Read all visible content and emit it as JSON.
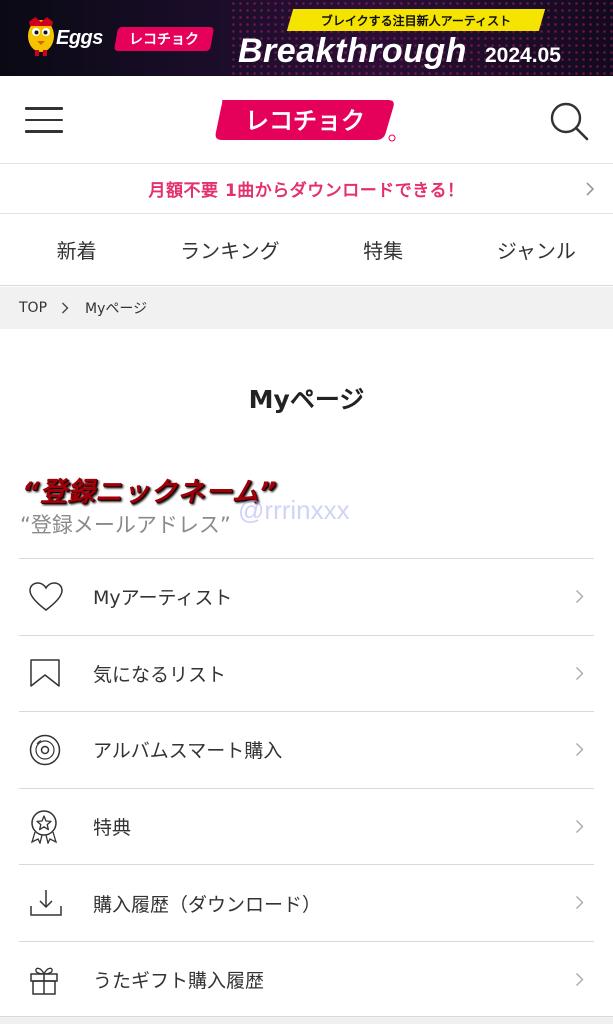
{
  "banner": {
    "brand_eggs": "Eggs",
    "brand_recochoku": "レコチョク",
    "tagline": "ブレイクする注目新人アーティスト",
    "title": "Breakthrough",
    "date": "2024.05"
  },
  "header": {
    "logo_text": "レコチョク",
    "menu_icon": "hamburger-icon",
    "search_icon": "search-icon"
  },
  "promo": {
    "text": "月額不要 1曲からダウンロードできる！"
  },
  "nav": {
    "tabs": [
      {
        "label": "新着"
      },
      {
        "label": "ランキング"
      },
      {
        "label": "特集"
      },
      {
        "label": "ジャンル"
      }
    ]
  },
  "breadcrumb": {
    "home": "TOP",
    "current": "Myページ"
  },
  "page": {
    "title": "Myページ"
  },
  "profile": {
    "nickname": "“登録ニックネーム”",
    "email": "“登録メールアドレス”",
    "handle_overlay": "@rrrinxxx"
  },
  "menu": {
    "items": [
      {
        "label": "Myアーティスト",
        "icon": "heart-icon"
      },
      {
        "label": "気になるリスト",
        "icon": "bookmark-icon"
      },
      {
        "label": "アルバムスマート購入",
        "icon": "disc-icon"
      },
      {
        "label": "特典",
        "icon": "badge-star-icon"
      },
      {
        "label": "購入履歴（ダウンロード）",
        "icon": "download-icon"
      },
      {
        "label": "うたギフト購入履歴",
        "icon": "gift-icon"
      }
    ]
  },
  "colors": {
    "brand_pink": "#e5005a",
    "promo_pink": "#e4306b",
    "banner_yellow": "#f5e400"
  }
}
